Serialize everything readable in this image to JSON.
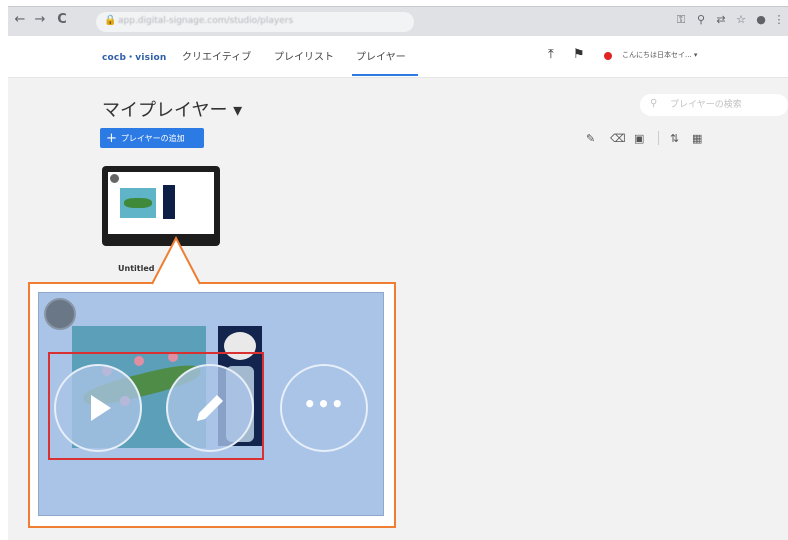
{
  "browser": {
    "url": "app.digital-signage.com/studio/players",
    "nav": {
      "back": "←",
      "forward": "→",
      "reload": "C"
    },
    "extension_icons": [
      "key-icon",
      "zoom-icon",
      "translate-icon",
      "star-icon",
      "profile-icon",
      "menu-icon"
    ]
  },
  "header": {
    "logo": "cocb・vision",
    "nav": [
      {
        "label": "クリエイティブ"
      },
      {
        "label": "プレイリスト"
      },
      {
        "label": "プレイヤー",
        "active": true
      }
    ],
    "user_label": "こんにちは日本セイ... ▾",
    "status_color": "#e02424"
  },
  "page": {
    "title": "マイプレイヤー ▾",
    "search_placeholder": "プレイヤーの検索",
    "add_button_label": "プレイヤーの追加",
    "toolbar_icons": [
      "edit-icon",
      "delete-icon",
      "copy-icon",
      "sort-icon",
      "grid-view-icon"
    ]
  },
  "player_card": {
    "name": "Untitled"
  },
  "preview_actions": [
    "play",
    "edit",
    "more"
  ],
  "colors": {
    "accent": "#2c7be5",
    "callout": "#ef7d32",
    "highlight": "#d93131"
  }
}
